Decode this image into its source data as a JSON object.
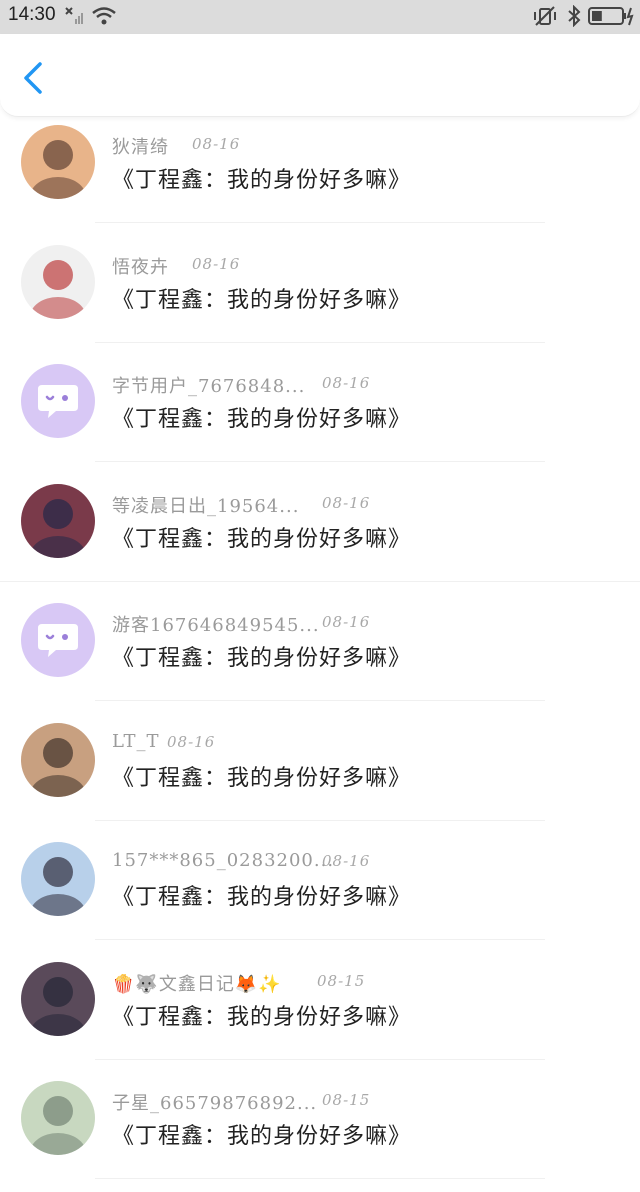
{
  "status_bar": {
    "time": "14:30",
    "battery_level": 0.35
  },
  "header": {
    "back_icon": "chevron-left-icon",
    "accent_color": "#2196f3"
  },
  "comments": [
    {
      "name": "狄清绮",
      "date": "08-16",
      "text": "《丁程鑫：我的身份好多嘛》",
      "avatar": "photo"
    },
    {
      "name": "悟夜卉",
      "date": "08-16",
      "text": "《丁程鑫：我的身份好多嘛》",
      "avatar": "photo"
    },
    {
      "name": "字节用户_7676848...",
      "date": "08-16",
      "text": "《丁程鑫：我的身份好多嘛》",
      "avatar": "default-chat-icon"
    },
    {
      "name": "等凌晨日出_19564...",
      "date": "08-16",
      "text": "《丁程鑫：我的身份好多嘛》",
      "avatar": "photo"
    },
    {
      "name": "游客167646849545...",
      "date": "08-16",
      "text": "《丁程鑫：我的身份好多嘛》",
      "avatar": "default-chat-icon"
    },
    {
      "name": "LT_T",
      "date": "08-16",
      "text": "《丁程鑫：我的身份好多嘛》",
      "avatar": "photo"
    },
    {
      "name": "157***865_0283200...",
      "date": "08-16",
      "text": "《丁程鑫：我的身份好多嘛》",
      "avatar": "photo"
    },
    {
      "name": "🍿🐺文鑫日记🦊✨",
      "date": "08-15",
      "text": "《丁程鑫：我的身份好多嘛》",
      "avatar": "photo"
    },
    {
      "name": "子星_66579876892...",
      "date": "08-15",
      "text": "《丁程鑫：我的身份好多嘛》",
      "avatar": "photo"
    }
  ]
}
